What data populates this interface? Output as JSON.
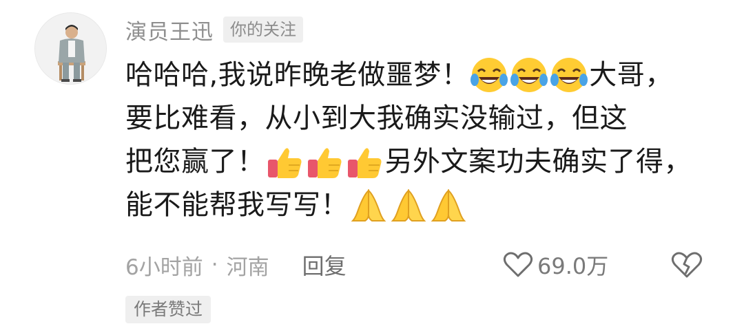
{
  "comment": {
    "author": "演员王迅",
    "follow_tag": "你的关注",
    "lines": [
      {
        "before": "哈哈哈,我说昨晚老做噩梦！",
        "emoji": "laugh-cry",
        "emoji_count": 3,
        "after": "大哥，"
      },
      {
        "text": "要比难看，从小到大我确实没输过，但这"
      },
      {
        "before": "把您赢了！",
        "emoji": "thumbs-up",
        "emoji_count": 3,
        "after": "另外文案功夫确实了得，"
      },
      {
        "before": "能不能帮我写写！",
        "emoji": "pray",
        "emoji_count": 3,
        "after": ""
      }
    ],
    "time": "6小时前",
    "separator": "·",
    "location": "河南",
    "reply_label": "回复",
    "likes": "69.0万",
    "author_liked_tag": "作者赞过"
  },
  "icons": {
    "like": "heart-outline-icon",
    "dislike": "broken-heart-icon"
  },
  "colors": {
    "author_name": "#8e8e8e",
    "body_text": "#1a1a1a",
    "meta_text": "#a3a3a3",
    "tag_bg": "#efefef"
  }
}
